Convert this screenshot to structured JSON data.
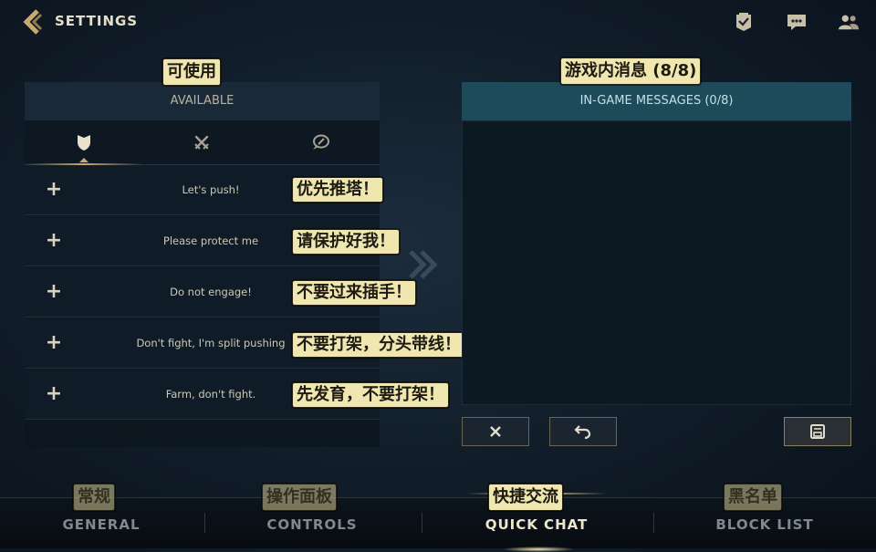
{
  "header": {
    "title": "SETTINGS",
    "icons": [
      "back-chevron-icon",
      "mission-badge-icon",
      "chat-bubble-icon",
      "friends-icon"
    ]
  },
  "available": {
    "header_label": "AVAILABLE",
    "annotation": "可使用",
    "tabs": [
      {
        "icon": "shield-icon",
        "active": true
      },
      {
        "icon": "crossed-swords-icon",
        "active": false
      },
      {
        "icon": "ping-chat-icon",
        "active": false
      }
    ],
    "messages": [
      {
        "text": "Let's push!",
        "annotation": "优先推塔！"
      },
      {
        "text": "Please protect me",
        "annotation": "请保护好我！"
      },
      {
        "text": "Do not engage!",
        "annotation": "不要过来插手！"
      },
      {
        "text": "Don't fight, I'm split pushing",
        "annotation": "不要打架，分头带线！"
      },
      {
        "text": "Farm, don't fight.",
        "annotation": "先发育，不要打架！"
      }
    ]
  },
  "in_game": {
    "header_label": "IN-GAME MESSAGES (0/8)",
    "annotation": "游戏内消息 (8/8)",
    "buttons": [
      "close-icon",
      "undo-icon",
      "save-icon"
    ]
  },
  "bottom_nav": {
    "items": [
      {
        "label": "GENERAL",
        "annotation": "常规",
        "active": false
      },
      {
        "label": "CONTROLS",
        "annotation": "操作面板",
        "active": false
      },
      {
        "label": "QUICK CHAT",
        "annotation": "快捷交流",
        "active": true
      },
      {
        "label": "BLOCK LIST",
        "annotation": "黑名单",
        "active": false
      }
    ]
  },
  "colors": {
    "gold": "#c8aa6e",
    "panel_dark": "#0f1c28",
    "teal_header": "#1e4b5a",
    "tag_bg": "#efe6b0"
  }
}
